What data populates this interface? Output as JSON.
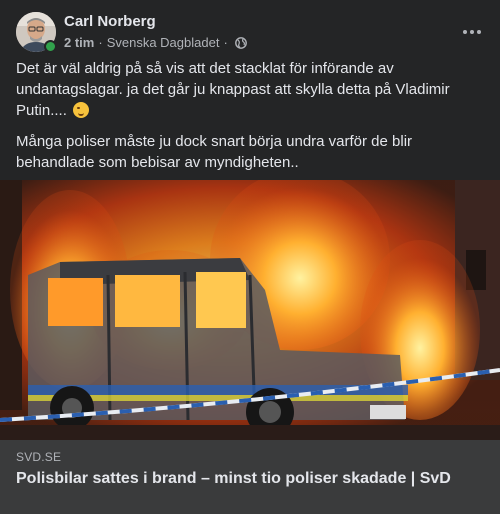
{
  "post": {
    "author": "Carl Norberg",
    "time": "2 tim",
    "source": "Svenska Dagbladet",
    "separator": "·",
    "paragraph_1": "Det är väl aldrig på så vis att det stacklat för införande av undantagslagar. ja det går ju knappast att skylla detta på Vladimir Putin.... ",
    "paragraph_2": "Många poliser måste ju dock snart börja undra varför de blir behandlade som bebisar av myndigheten..",
    "emoji": "sweat-smile-emoji"
  },
  "link_preview": {
    "domain": "SVD.SE",
    "headline": "Polisbilar sattes i brand – minst tio poliser skadade | SvD"
  },
  "photo": {
    "description_icon": "burning-police-van-photo"
  },
  "colors": {
    "background": "#242526",
    "link_card": "#3a3b3c",
    "text_primary": "#e4e6eb",
    "text_secondary": "#b0b3b8",
    "online": "#31a24c"
  }
}
